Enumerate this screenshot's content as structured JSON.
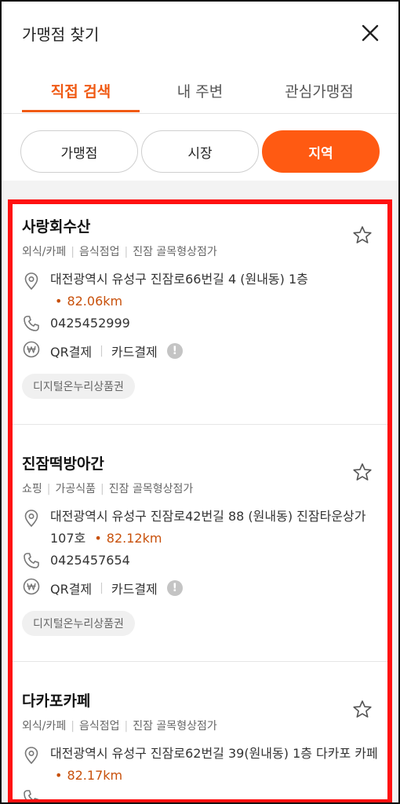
{
  "header": {
    "title": "가맹점 찾기"
  },
  "tabs": [
    {
      "label": "직접 검색",
      "active": true
    },
    {
      "label": "내 주변",
      "active": false
    },
    {
      "label": "관심가맹점",
      "active": false
    }
  ],
  "filters": [
    {
      "label": "가맹점",
      "active": false
    },
    {
      "label": "시장",
      "active": false
    },
    {
      "label": "지역",
      "active": true
    }
  ],
  "colors": {
    "accent": "#ff5a12",
    "highlight": "#ff1111",
    "distance": "#c8500a"
  },
  "stores": [
    {
      "name": "사랑회수산",
      "categories": [
        "외식/카페",
        "음식점업",
        "진잠 골목형상점가"
      ],
      "address": "대전광역시 유성구 진잠로66번길 4 (원내동) 1층",
      "distance": "82.06km",
      "phone": "0425452999",
      "payments": [
        "QR결제",
        "카드결제"
      ],
      "tag": "디지털온누리상품권"
    },
    {
      "name": "진잠떡방아간",
      "categories": [
        "쇼핑",
        "가공식품",
        "진잠 골목형상점가"
      ],
      "address": "대전광역시 유성구 진잠로42번길 88 (원내동) 진잠타운상가 107호",
      "distance": "82.12km",
      "phone": "0425457654",
      "payments": [
        "QR결제",
        "카드결제"
      ],
      "tag": "디지털온누리상품권"
    },
    {
      "name": "다카포카페",
      "categories": [
        "외식/카페",
        "음식점업",
        "진잠 골목형상점가"
      ],
      "address": "대전광역시 유성구 진잠로62번길 39(원내동) 1층 다카포 카페",
      "distance": "82.17km"
    }
  ]
}
